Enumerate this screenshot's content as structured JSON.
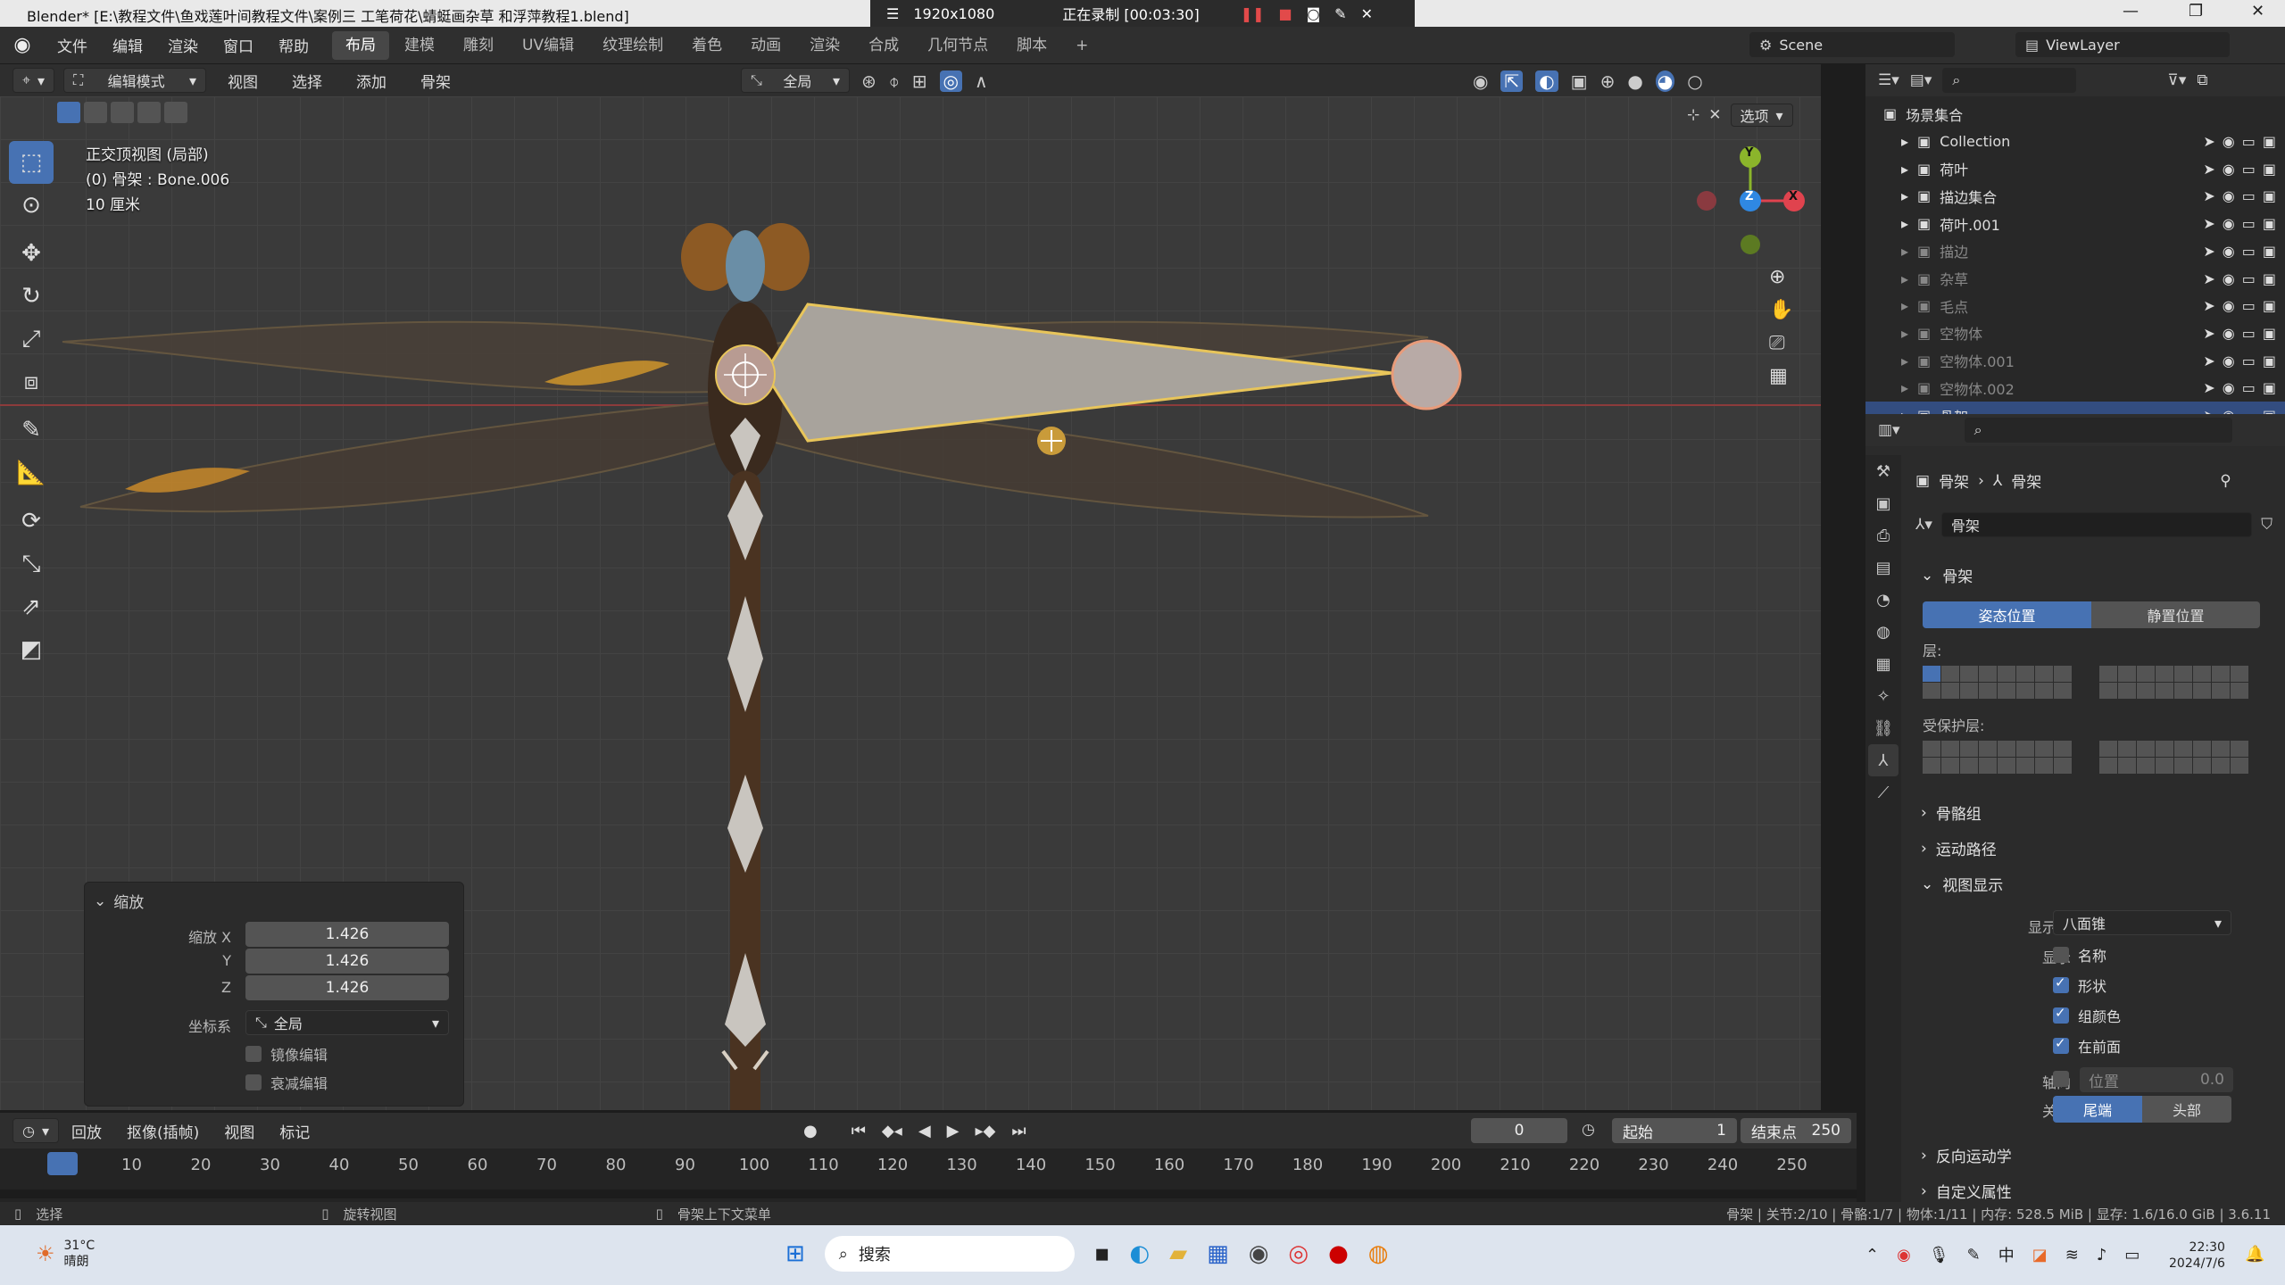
{
  "titlebar": {
    "title": "Blender* [E:\\教程文件\\鱼戏莲叶间教程文件\\案例三 工笔荷花\\蜻蜓画杂草 和浮萍教程1.blend]",
    "resolution": "1920x1080",
    "recording": "正在录制 [00:03:30]"
  },
  "menu": [
    "文件",
    "编辑",
    "渲染",
    "窗口",
    "帮助"
  ],
  "workspaces": [
    "布局",
    "建模",
    "雕刻",
    "UV编辑",
    "纹理绘制",
    "着色",
    "动画",
    "渲染",
    "合成",
    "几何节点",
    "脚本"
  ],
  "active_workspace": "布局",
  "scene": "Scene",
  "view_layer": "ViewLayer",
  "header": {
    "mode": "编辑模式",
    "menus": [
      "视图",
      "选择",
      "添加",
      "骨架"
    ],
    "orientation": "全局",
    "options": "选项"
  },
  "viewport": {
    "view_name": "正交顶视图 (局部)",
    "object": "(0) 骨架 : Bone.006",
    "scale": "10 厘米",
    "gizmo": {
      "x": "X",
      "y": "Y",
      "z": "Z"
    }
  },
  "redo_panel": {
    "title": "缩放",
    "fields": [
      {
        "label": "缩放 X",
        "value": "1.426"
      },
      {
        "label": "Y",
        "value": "1.426"
      },
      {
        "label": "Z",
        "value": "1.426"
      }
    ],
    "coord_label": "坐标系",
    "coord_value": "全局",
    "mirror": "镜像编辑",
    "proportional": "衰减编辑"
  },
  "timeline": {
    "menus": [
      "回放",
      "抠像(插帧)",
      "视图",
      "标记"
    ],
    "current_frame": "0",
    "start_label": "起始",
    "start": "1",
    "end_label": "结束点",
    "end": "250",
    "ticks": [
      "0",
      "10",
      "20",
      "30",
      "40",
      "50",
      "60",
      "70",
      "80",
      "90",
      "100",
      "110",
      "120",
      "130",
      "140",
      "150",
      "160",
      "170",
      "180",
      "190",
      "200",
      "210",
      "220",
      "230",
      "240",
      "250"
    ]
  },
  "status": {
    "left": "选择",
    "middle": "旋转视图",
    "right_ctx": "骨架上下文菜单",
    "stats": "骨架 | 关节:2/10 | 骨骼:1/7 | 物体:1/11 | 内存: 528.5 MiB | 显存: 1.6/16.0 GiB | 3.6.11"
  },
  "outliner": {
    "root": "场景集合",
    "rows": [
      {
        "name": "Collection",
        "dim": false,
        "sel": false
      },
      {
        "name": "荷叶",
        "dim": false,
        "sel": false
      },
      {
        "name": "描边集合",
        "dim": false,
        "sel": false
      },
      {
        "name": "荷叶.001",
        "dim": false,
        "sel": false
      },
      {
        "name": "描边",
        "dim": true,
        "sel": false
      },
      {
        "name": "杂草",
        "dim": true,
        "sel": false
      },
      {
        "name": "毛点",
        "dim": true,
        "sel": false
      },
      {
        "name": "空物体",
        "dim": true,
        "sel": false
      },
      {
        "name": "空物体.001",
        "dim": true,
        "sel": false
      },
      {
        "name": "空物体.002",
        "dim": true,
        "sel": false
      },
      {
        "name": "骨架",
        "dim": false,
        "sel": true
      }
    ]
  },
  "properties": {
    "breadcrumb": [
      "骨架",
      "骨架"
    ],
    "datablock": "骨架",
    "panel_skeleton": "骨架",
    "pose_position": "姿态位置",
    "rest_position": "静置位置",
    "layers_label": "层:",
    "protected_label": "受保护层:",
    "collapsed": [
      "骨骼组",
      "运动路径"
    ],
    "viewport_display": "视图显示",
    "display_as_label": "显示为",
    "display_as": "八面锥",
    "show_label": "显示",
    "show_options": [
      {
        "label": "名称",
        "checked": false
      },
      {
        "label": "形状",
        "checked": true
      },
      {
        "label": "组颜色",
        "checked": true
      },
      {
        "label": "在前面",
        "checked": true
      }
    ],
    "axes_label": "轴向",
    "axes_pos_label": "位置",
    "axes_pos_value": "0.0",
    "relation_label": "关系",
    "tail": "尾端",
    "head": "头部",
    "ik": "反向运动学",
    "custom": "自定义属性"
  },
  "taskbar": {
    "search": "搜索",
    "weather_temp": "31°C",
    "weather_desc": "晴朗",
    "time": "22:30",
    "date": "2024/7/6"
  },
  "colors": {
    "accent": "#4772b3",
    "selected_row": "#334d80",
    "bone_fill": "#a8a39c",
    "bone_outline": "#e8c55a",
    "gizmo_x": "#e0434e",
    "gizmo_y": "#8bb52b",
    "gizmo_z": "#2f88e2"
  }
}
